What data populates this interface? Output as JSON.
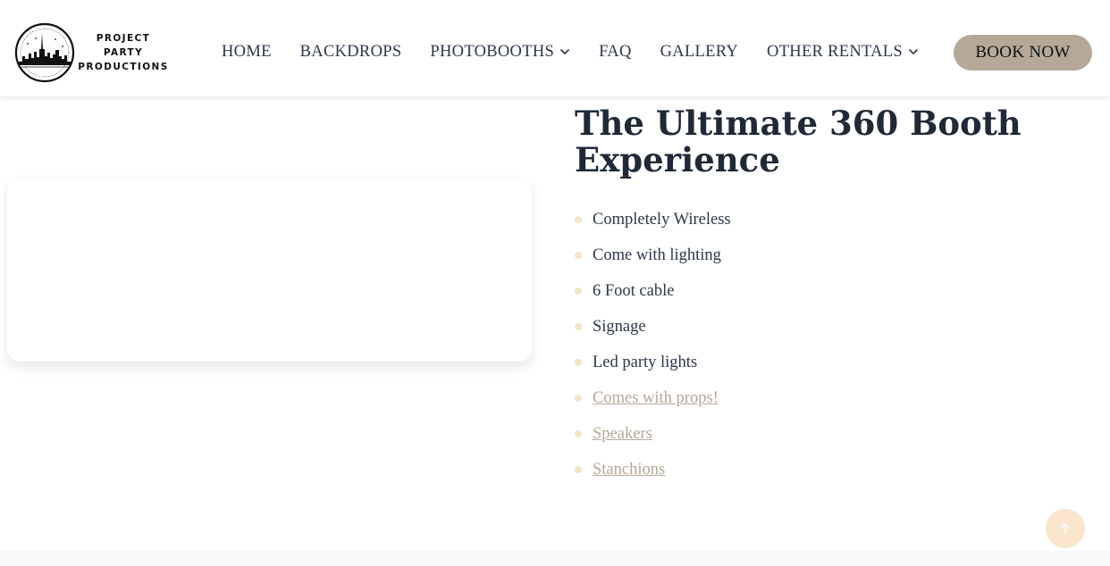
{
  "brand": {
    "line1": "PROJECT PARTY",
    "line2": "PRODUCTIONS"
  },
  "nav": {
    "home": "HOME",
    "backdrops": "BACKDROPS",
    "photobooths": "PHOTOBOOTHS",
    "faq": "FAQ",
    "gallery": "GALLERY",
    "other_rentals": "OTHER RENTALS"
  },
  "book_button": "BOOK NOW",
  "hero": {
    "title_line1": "The Ultimate 360 Booth",
    "title_line2": "Experience"
  },
  "features": [
    {
      "label": "Completely Wireless",
      "link": false
    },
    {
      "label": "Come with lighting",
      "link": false
    },
    {
      "label": "6 Foot cable",
      "link": false
    },
    {
      "label": "Signage",
      "link": false
    },
    {
      "label": "Led party lights",
      "link": false
    },
    {
      "label": "Comes with props!",
      "link": true
    },
    {
      "label": "Speakers",
      "link": true
    },
    {
      "label": "Stanchions",
      "link": true
    }
  ],
  "icons": {
    "logo": "city-skyline-badge-icon",
    "dropdown": "chevron-down-icon",
    "scroll_top": "arrow-up-icon"
  },
  "colors": {
    "accent": "#b5a898",
    "bullet": "#f6e3c8",
    "heading": "#1f2937",
    "scroll_button": "#f9e6cc"
  }
}
